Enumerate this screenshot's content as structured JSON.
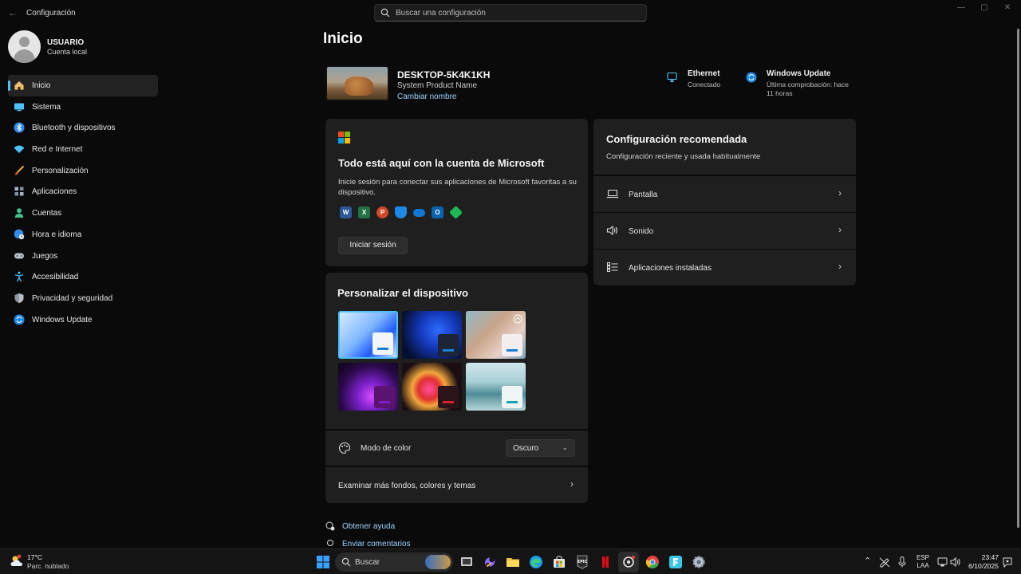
{
  "window": {
    "title": "Configuración",
    "back_glyph": "←",
    "controls": [
      "—",
      "▢",
      "✕"
    ]
  },
  "search": {
    "placeholder": "Buscar una configuración",
    "icon": "search-icon"
  },
  "profile": {
    "name": "USUARIO",
    "account_type": "Cuenta local"
  },
  "sidebar": {
    "items": [
      {
        "label": "Inicio",
        "icon": "home-icon",
        "active": true
      },
      {
        "label": "Sistema",
        "icon": "monitor-icon"
      },
      {
        "label": "Bluetooth y dispositivos",
        "icon": "bluetooth-icon"
      },
      {
        "label": "Red e Internet",
        "icon": "wifi-icon"
      },
      {
        "label": "Personalización",
        "icon": "brush-icon"
      },
      {
        "label": "Aplicaciones",
        "icon": "apps-icon"
      },
      {
        "label": "Cuentas",
        "icon": "person-icon"
      },
      {
        "label": "Hora e idioma",
        "icon": "globe-clock-icon"
      },
      {
        "label": "Juegos",
        "icon": "gamepad-icon"
      },
      {
        "label": "Accesibilidad",
        "icon": "accessibility-icon"
      },
      {
        "label": "Privacidad y seguridad",
        "icon": "shield-icon"
      },
      {
        "label": "Windows Update",
        "icon": "update-icon"
      }
    ]
  },
  "page": {
    "title": "Inicio"
  },
  "device": {
    "name": "DESKTOP-5K4K1KH",
    "model": "System Product Name",
    "rename_link": "Cambiar nombre"
  },
  "status": {
    "network": {
      "title": "Ethernet",
      "subtitle": "Conectado",
      "icon": "ethernet-icon"
    },
    "update": {
      "title": "Windows Update",
      "subtitle": "Última comprobación: hace 11 horas",
      "icon": "update-icon"
    }
  },
  "microsoft_card": {
    "title": "Todo está aquí con la cuenta de Microsoft",
    "description": "Inicie sesión para conectar sus aplicaciones de Microsoft favoritas a su dispositivo.",
    "signin_button": "Iniciar sesión",
    "apps": [
      {
        "icon": "word-icon",
        "glyph": "W",
        "color": "#2b579a"
      },
      {
        "icon": "excel-icon",
        "glyph": "X",
        "color": "#217346"
      },
      {
        "icon": "powerpoint-icon",
        "glyph": "P",
        "color": "#d24726"
      },
      {
        "icon": "defender-icon",
        "glyph": "",
        "color": "#1e88e5"
      },
      {
        "icon": "onedrive-icon",
        "glyph": "",
        "color": "#0f78d4"
      },
      {
        "icon": "outlook-icon",
        "glyph": "O",
        "color": "#0a64ad"
      },
      {
        "icon": "family-icon",
        "glyph": "",
        "color": "#1db954"
      }
    ]
  },
  "recommended": {
    "title": "Configuración recomendada",
    "subtitle": "Configuración reciente y usada habitualmente",
    "items": [
      {
        "label": "Pantalla",
        "icon": "laptop-icon"
      },
      {
        "label": "Sonido",
        "icon": "speaker-icon"
      },
      {
        "label": "Aplicaciones instaladas",
        "icon": "list-icon"
      }
    ]
  },
  "personalize": {
    "title": "Personalizar el dispositivo",
    "themes": [
      {
        "name": "windows-light-theme"
      },
      {
        "name": "windows-dark-theme"
      },
      {
        "name": "flowers-theme"
      },
      {
        "name": "glow-theme"
      },
      {
        "name": "captured-motion-theme"
      },
      {
        "name": "sunrise-theme"
      }
    ],
    "color_mode_label": "Modo de color",
    "color_mode_value": "Oscuro",
    "more_link": "Examinar más fondos, colores y temas"
  },
  "help": {
    "get_help": "Obtener ayuda",
    "feedback": "Enviar comentarios"
  },
  "taskbar": {
    "weather_temp": "17°C",
    "weather_desc": "Parc. nublado",
    "search_label": "Buscar",
    "lang_top": "ESP",
    "lang_bottom": "LAA",
    "time": "23:47",
    "date": "6/10/2025"
  },
  "colors": {
    "accent": "#4cc2ff",
    "link": "#9ad4ff",
    "background": "#0a0a0a",
    "card": "#1f1f1f"
  }
}
